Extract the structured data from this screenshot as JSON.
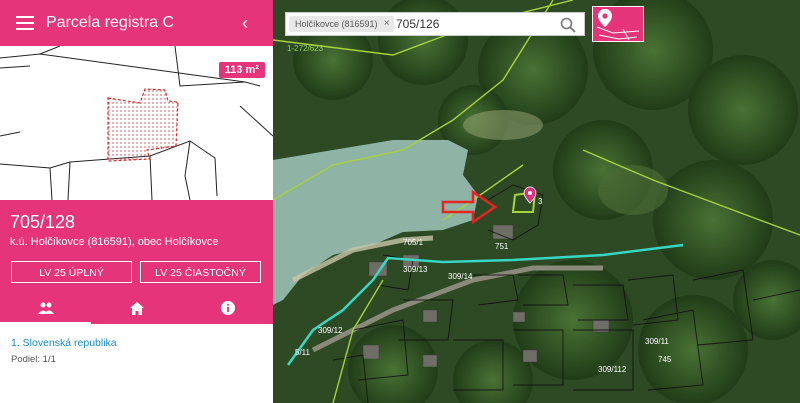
{
  "panel": {
    "title": "Parcela registra C",
    "area_badge": "113 m²",
    "parcel_number": "705/128",
    "parcel_location": "k.ú. Holčíkovce (816591), obec Holčíkovce",
    "buttons": {
      "lv_full": "LV 25 ÚPLNÝ",
      "lv_partial": "LV 25 ČIASTOČNÝ"
    },
    "tabs": [
      {
        "icon": "people-icon",
        "active": true
      },
      {
        "icon": "home-icon",
        "active": false
      },
      {
        "icon": "info-icon",
        "active": false
      }
    ],
    "owners": [
      {
        "name": "1. Slovenská republika",
        "share": "Podiel: 1/1"
      }
    ]
  },
  "search": {
    "chip_label": "Holčíkovce (816591)",
    "query": "705/126"
  },
  "map": {
    "coord_label": "1-272/623",
    "parcel_labels": [
      "705/1",
      "3",
      "309/13",
      "309/14",
      "309/12",
      "5/11",
      "751",
      "309/11",
      "309/112",
      "745"
    ]
  },
  "colors": {
    "accent": "#e6347a",
    "boundary_green": "#a6d33c",
    "boundary_cyan": "#39d6c4"
  }
}
